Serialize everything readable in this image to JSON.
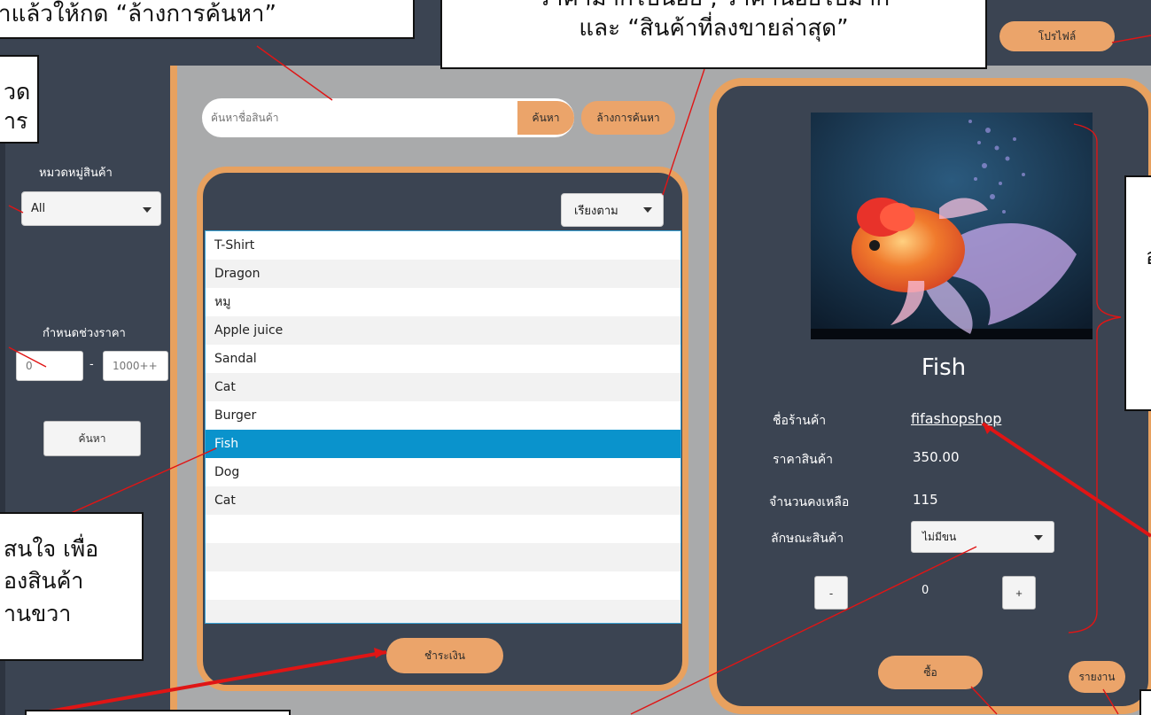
{
  "header": {
    "profile_label": "โปรไฟล์"
  },
  "sidebar": {
    "category_label": "หมวดหมู่สินค้า",
    "category_value": "All",
    "price_range_label": "กำหนดช่วงราคา",
    "price_min_placeholder": "0",
    "price_max_placeholder": "1000++",
    "price_separator": "-",
    "search_button": "ค้นหา"
  },
  "search": {
    "placeholder": "ค้นหาชื่อสินค้า",
    "search_button": "ค้นหา",
    "clear_button": "ล้างการค้นหา"
  },
  "product_list": {
    "sort_label": "เรียงตาม",
    "items": [
      "T-Shirt",
      "Dragon",
      "หมู",
      "Apple juice",
      "Sandal",
      "Cat",
      "Burger",
      "Fish",
      "Dog",
      "Cat"
    ],
    "selected_index": 7,
    "checkout_button": "ชำระเงิน"
  },
  "detail": {
    "name": "Fish",
    "shop_label": "ชื่อร้านค้า",
    "shop_name": "fifashopshop",
    "price_label": "ราคาสินค้า",
    "price": "350.00",
    "stock_label": "จำนวนคงเหลือ",
    "stock": "115",
    "feature_label": "ลักษณะสินค้า",
    "feature_value": "ไม่มีขน",
    "minus": "-",
    "quantity": "0",
    "plus": "+",
    "buy_button": "ซื้อ",
    "report_button": "รายงาน"
  },
  "callouts": {
    "top_left": "าแล้วให้กด “ล้างการค้นหา”",
    "top_center_line1": "ราคามากไปน้อย , ราคาน้อยไปมาก",
    "top_center_line2": "และ “สินค้าที่ลงขายล่าสุด”",
    "left_line1": "วด",
    "left_line2": "าร",
    "bottom_left_line1": "สนใจ เพื่อ",
    "bottom_left_line2": "องสินค้า",
    "bottom_left_line3": "านขวา",
    "right_line1": "อ"
  },
  "colors": {
    "panel": "#3b4452",
    "accent": "#e8a15f",
    "selected": "#0a93cc",
    "background": "#a9aaab"
  }
}
